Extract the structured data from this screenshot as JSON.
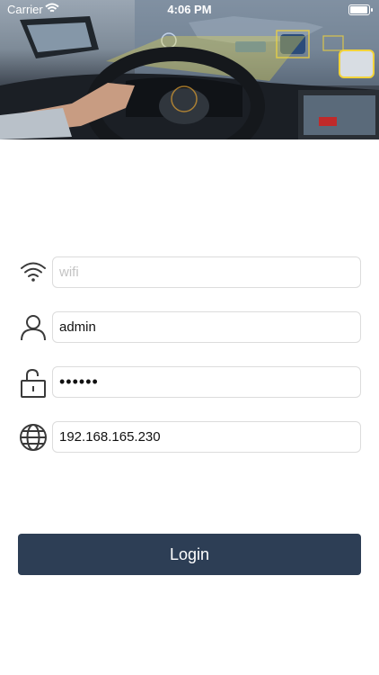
{
  "status_bar": {
    "carrier": "Carrier",
    "time": "4:06 PM"
  },
  "hero": {
    "description_icon": "car-dashboard-photo"
  },
  "form": {
    "wifi": {
      "placeholder": "wifi",
      "value": "",
      "icon": "wifi-icon"
    },
    "username": {
      "value": "admin",
      "icon": "user-icon"
    },
    "password": {
      "value": "abcdef",
      "icon": "lock-icon"
    },
    "ip": {
      "value": "192.168.165.230",
      "icon": "globe-icon"
    }
  },
  "login_button": {
    "label": "Login"
  },
  "colors": {
    "button_bg": "#2d3e55",
    "input_border": "#dcdcdc",
    "icon_stroke": "#3a3a3a"
  }
}
